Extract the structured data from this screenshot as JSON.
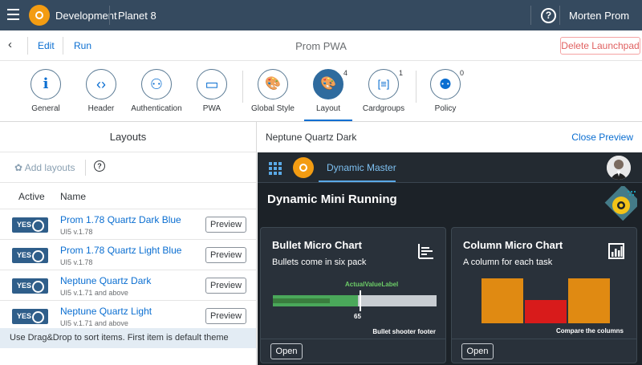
{
  "shell": {
    "app_title": "Development",
    "workspace": "Planet 8",
    "help_glyph": "?",
    "user": "Morten Prom"
  },
  "toolbar": {
    "edit": "Edit",
    "run": "Run",
    "title": "Prom PWA",
    "delete": "Delete Launchpad"
  },
  "tabs": [
    {
      "label": "General",
      "icon": "info-icon",
      "glyph": "i",
      "count": ""
    },
    {
      "label": "Header",
      "icon": "code-icon",
      "glyph": "‹›",
      "count": ""
    },
    {
      "label": "Authentication",
      "icon": "users-icon",
      "glyph": "⚇",
      "count": ""
    },
    {
      "label": "PWA",
      "icon": "devices-icon",
      "glyph": "▭",
      "count": ""
    },
    {
      "label": "Global Style",
      "icon": "palette-icon",
      "glyph": "🎨",
      "count": ""
    },
    {
      "label": "Layout",
      "icon": "palette-icon",
      "glyph": "🎨",
      "count": "4"
    },
    {
      "label": "Cardgroups",
      "icon": "list-icon",
      "glyph": "[≡]",
      "count": "1"
    },
    {
      "label": "Policy",
      "icon": "user-lock-icon",
      "glyph": "⚉",
      "count": "0"
    }
  ],
  "layouts": {
    "title": "Layouts",
    "add": "Add layouts",
    "col_active": "Active",
    "col_name": "Name",
    "toggle_label": "YES",
    "preview_label": "Preview",
    "rows": [
      {
        "name": "Prom 1.78 Quartz Dark Blue",
        "version": "UI5 v.1.78"
      },
      {
        "name": "Prom 1.78 Quartz Light Blue",
        "version": "UI5 v.1.78"
      },
      {
        "name": "Neptune Quartz Dark",
        "version": "UI5 v.1.71 and above"
      },
      {
        "name": "Neptune Quartz Light",
        "version": "UI5 v.1.71 and above"
      }
    ],
    "footer": "Use Drag&Drop to sort items. First item is default theme"
  },
  "preview": {
    "theme": "Neptune Quartz Dark",
    "close": "Close Preview",
    "shell_title": "Dynamic Master",
    "page_title": "Dynamic Mini Running",
    "bullet_card": {
      "title": "Bullet Micro Chart",
      "subtitle": "Bullets come in six pack",
      "value_label": "ActualValueLabel",
      "target_value": "65",
      "footer": "Bullet shooter footer",
      "open": "Open",
      "fill_fraction": 0.52,
      "actual_fraction": 0.35,
      "target_fraction": 0.53
    },
    "column_card": {
      "title": "Column Micro Chart",
      "subtitle": "A column for each task",
      "footer": "Compare the columns",
      "open": "Open",
      "columns": [
        {
          "value": 1.0,
          "color": "#e08a12"
        },
        {
          "value": 0.52,
          "color": "#d81b1b"
        },
        {
          "value": 1.0,
          "color": "#e08a12"
        }
      ]
    }
  },
  "colors": {
    "shell": "#354a5f",
    "accent": "#0a6ed1",
    "logo": "#f39c12",
    "toggle": "#2f5e8a"
  }
}
